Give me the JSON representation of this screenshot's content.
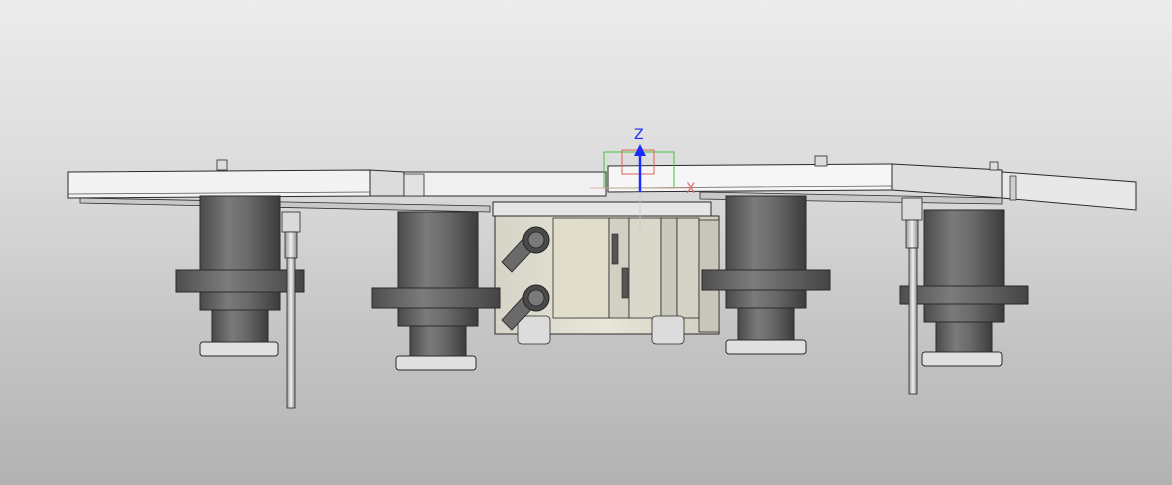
{
  "viewport": {
    "background_top": "#ececec",
    "background_bottom": "#b2b2b2"
  },
  "triad": {
    "z_label": "Z",
    "x_label": "X",
    "z_color": "#1a2cff",
    "x_color": "#e06060",
    "box_color": "#3fc43f"
  },
  "model": {
    "body_color": "#6e6e6e",
    "plate_color": "#f4f4f4",
    "block_color": "#e4e2d4",
    "edge_color": "#2a2a2a"
  }
}
